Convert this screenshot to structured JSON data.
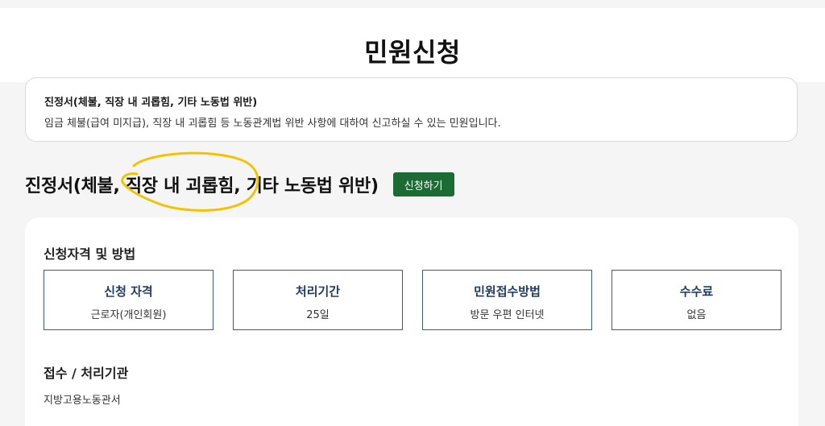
{
  "header": {
    "title": "민원신청"
  },
  "info": {
    "title": "진정서(체불, 직장 내 괴롭힘, 기타 노동법 위반)",
    "description": "임금 체불(급여 미지급), 직장 내 괴롭힘 등 노동관계법 위반 사항에 대하여 신고하실 수 있는 민원입니다."
  },
  "main": {
    "heading": "진정서(체불, 직장 내 괴롭힘, 기타 노동법 위반)",
    "apply_label": "신청하기",
    "highlight_color": "#f2c300",
    "button_color": "#1d6b34"
  },
  "qualification": {
    "title": "신청자격 및 방법",
    "tiles": [
      {
        "label": "신청 자격",
        "value": "근로자(개인회원)"
      },
      {
        "label": "처리기간",
        "value": "25일"
      },
      {
        "label": "민원접수방법",
        "value": "방문 우편 인터넷"
      },
      {
        "label": "수수료",
        "value": "없음"
      }
    ]
  },
  "agency": {
    "title": "접수 / 처리기관",
    "value": "지방고용노동관서"
  }
}
